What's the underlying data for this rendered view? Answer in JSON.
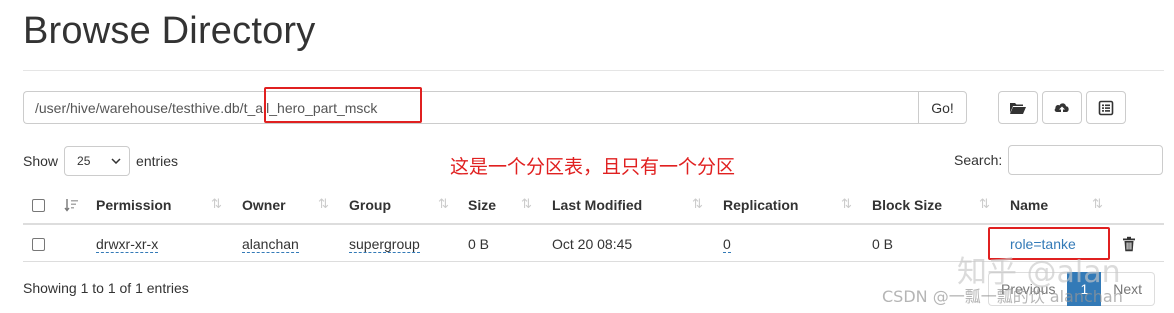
{
  "header": {
    "title": "Browse Directory"
  },
  "path_bar": {
    "value": "/user/hive/warehouse/testhive.db/t_all_hero_part_msck",
    "go_label": "Go!"
  },
  "toolbar": {
    "buttons": [
      {
        "icon": "folder-open-icon"
      },
      {
        "icon": "cloud-upload-icon"
      },
      {
        "icon": "list-alt-icon"
      }
    ]
  },
  "annotation": {
    "text": "这是一个分区表，且只有一个分区",
    "color": "#e02020"
  },
  "length_menu": {
    "show_label": "Show",
    "selected": "25",
    "entries_label": "entries"
  },
  "search": {
    "label": "Search:",
    "value": ""
  },
  "table": {
    "columns": [
      "Permission",
      "Owner",
      "Group",
      "Size",
      "Last Modified",
      "Replication",
      "Block Size",
      "Name"
    ],
    "rows": [
      {
        "permission": "drwxr-xr-x",
        "owner": "alanchan",
        "group": "supergroup",
        "size": "0 B",
        "last_modified": "Oct 20 08:45",
        "replication": "0",
        "block_size": "0 B",
        "name": "role=tanke"
      }
    ]
  },
  "footer": {
    "info": "Showing 1 to 1 of 1 entries",
    "pagination": {
      "previous": "Previous",
      "current": "1",
      "next": "Next"
    }
  },
  "watermarks": {
    "zhihu": "知乎 @alan",
    "csdn": "CSDN @一瓢一瓢的饮 alanchan"
  },
  "colors": {
    "link": "#337ab7",
    "annotation": "#e02020",
    "border": "#cccccc"
  }
}
